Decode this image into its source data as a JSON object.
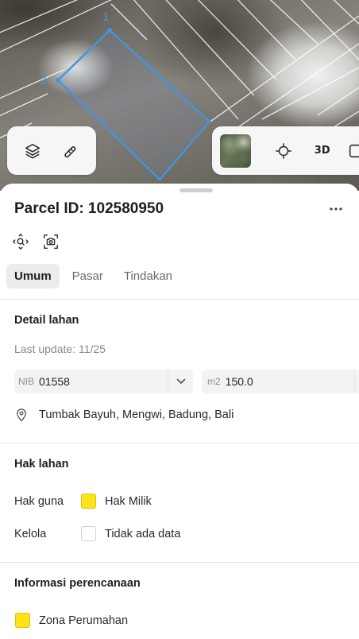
{
  "map": {
    "parcel_vertex_labels": [
      "1",
      "2"
    ],
    "parcel_outline_color": "#3f97e0",
    "layers_icon": "layers-icon",
    "measure_icon": "measure-icon",
    "locate_icon": "crosshair-icon",
    "view_3d_label": "3D",
    "fullscreen_icon": "expand-icon"
  },
  "sheet": {
    "title": "Parcel ID: 102580950",
    "more_icon": "more-horizontal-icon",
    "tools": [
      "focus-parcel-icon",
      "screenshot-icon"
    ],
    "tabs": [
      {
        "label": "Umum",
        "active": true
      },
      {
        "label": "Pasar",
        "active": false
      },
      {
        "label": "Tindakan",
        "active": false
      }
    ],
    "detail": {
      "title": "Detail lahan",
      "last_update": "Last update: 11/25",
      "nib_prefix": "NIB",
      "nib_value": "01558",
      "area_prefix": "m2",
      "area_value": "150.0",
      "location": "Tumbak Bayuh, Mengwi, Badung, Bali"
    },
    "rights": {
      "title": "Hak lahan",
      "hak_guna_label": "Hak guna",
      "hak_guna_value": "Hak Milik",
      "hak_guna_color": "#ffe11c",
      "kelola_label": "Kelola",
      "kelola_value": "Tidak ada data",
      "kelola_color": "#ffffff"
    },
    "planning": {
      "title": "Informasi perencanaan",
      "zone_label": "Zona Perumahan",
      "zone_color": "#ffe11c"
    }
  }
}
